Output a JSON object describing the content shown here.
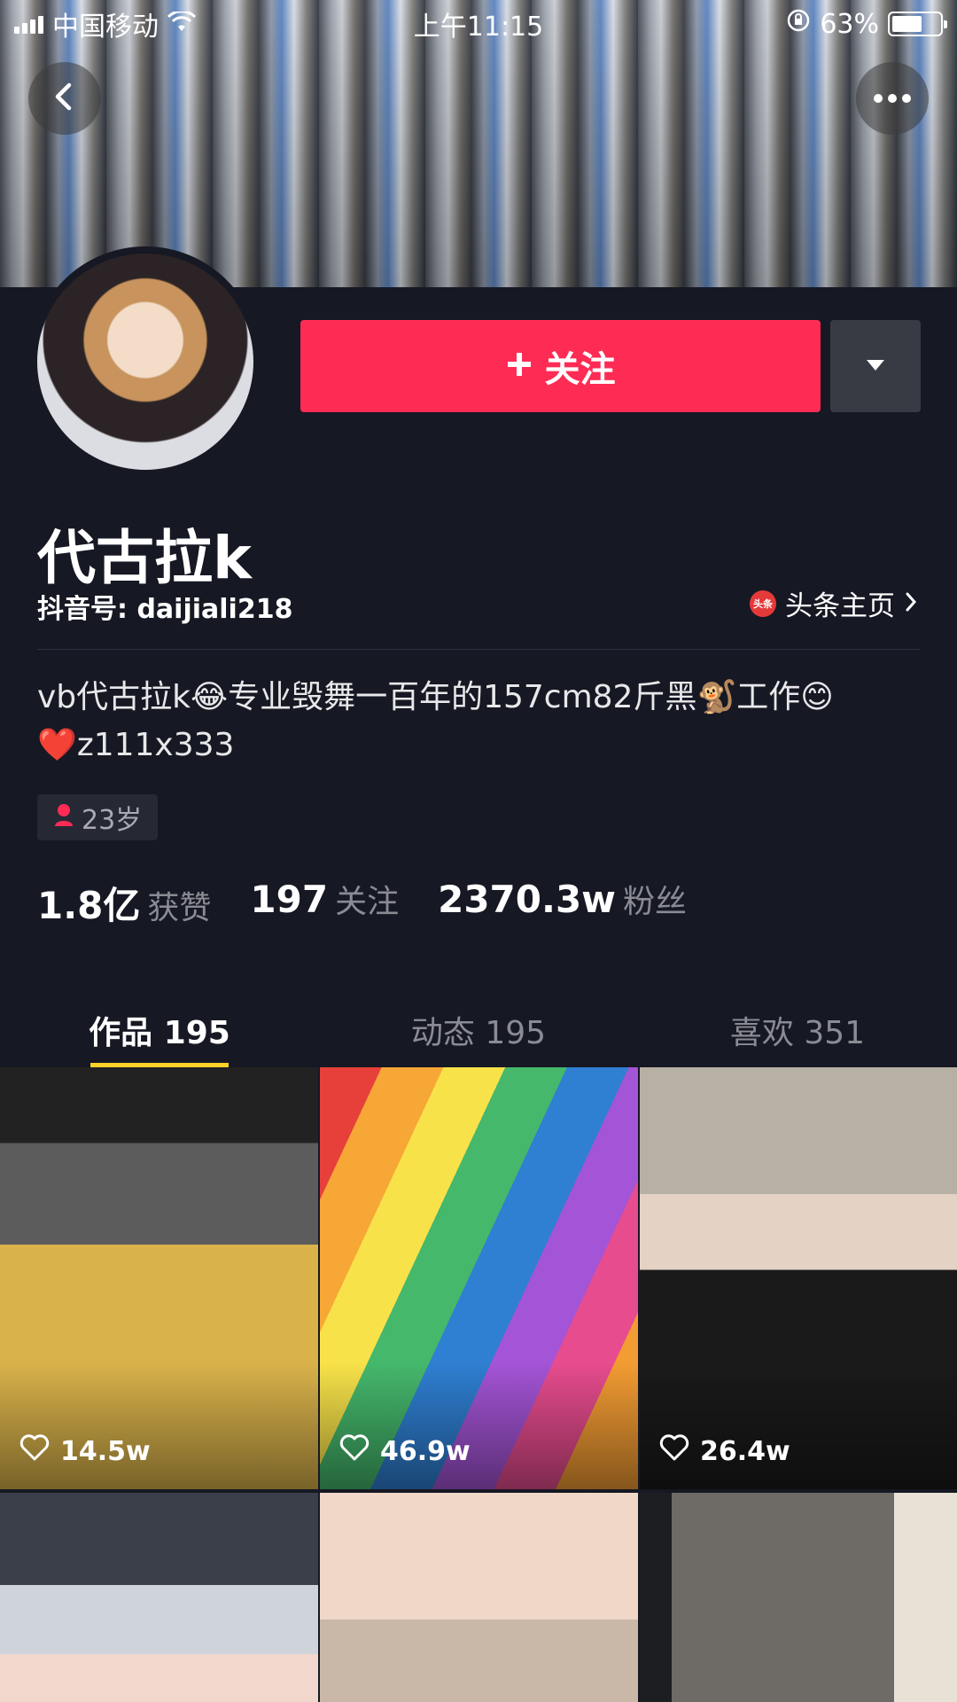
{
  "status_bar": {
    "carrier": "中国移动",
    "time": "上午11:15",
    "battery": "63%",
    "battery_level": 0.63
  },
  "header": {
    "back_icon": "chevron-left-icon",
    "more_icon": "ellipsis-icon"
  },
  "profile": {
    "follow_label": "关注",
    "name": "代古拉k",
    "douyin_id": "抖音号: daijiali218",
    "toutiao_logo_text": "头条",
    "toutiao_link": "头条主页",
    "bio_line1": "vb代古拉k😂专业毁舞一百年的157cm82斤黑🐒工作😊",
    "bio_line2": "❤️z111x333",
    "age": "23岁"
  },
  "stats": [
    {
      "num": "1.8亿",
      "label": "获赞"
    },
    {
      "num": "197",
      "label": "关注"
    },
    {
      "num": "2370.3w",
      "label": "粉丝"
    }
  ],
  "tabs": [
    {
      "label": "作品 195",
      "active": true
    },
    {
      "label": "动态 195",
      "active": false
    },
    {
      "label": "喜欢 351",
      "active": false
    }
  ],
  "videos": [
    {
      "likes": "14.5w"
    },
    {
      "likes": "46.9w"
    },
    {
      "likes": "26.4w"
    },
    {
      "likes": ""
    },
    {
      "likes": ""
    },
    {
      "likes": ""
    }
  ],
  "colors": {
    "background": "#161823",
    "accent": "#fe2c55",
    "tab_indicator": "#fcd12a"
  }
}
